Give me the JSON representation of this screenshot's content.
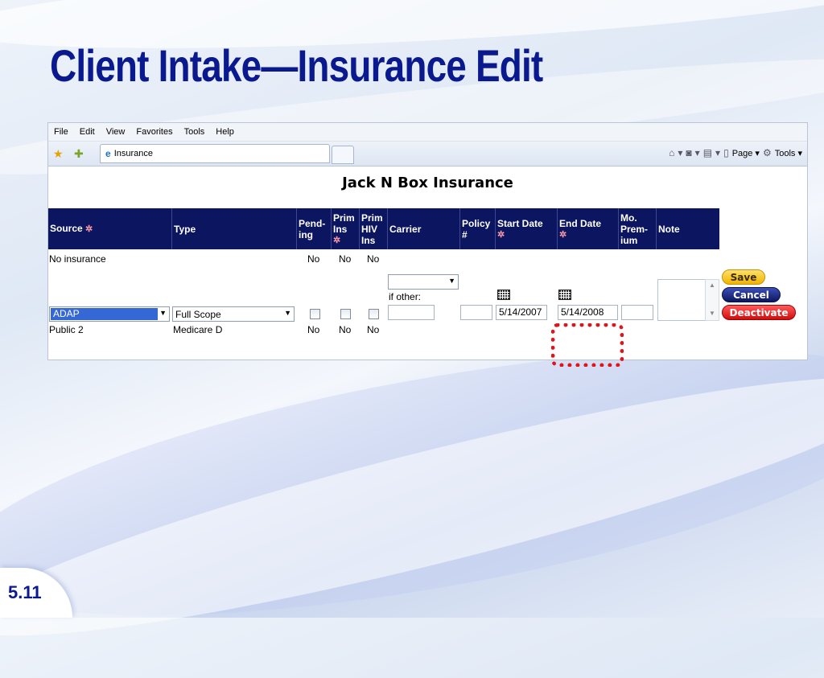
{
  "slide": {
    "title": "Client Intake—Insurance Edit",
    "number": "5.11"
  },
  "browser": {
    "menu": [
      "File",
      "Edit",
      "View",
      "Favorites",
      "Tools",
      "Help"
    ],
    "tab_title": "Insurance",
    "tools": {
      "page": "Page ▾",
      "tools": "Tools ▾"
    }
  },
  "page": {
    "heading": "Jack N Box Insurance",
    "columns": {
      "source": "Source",
      "type": "Type",
      "pending": [
        "Pend-",
        "ing"
      ],
      "prim_ins": [
        "Prim",
        "Ins"
      ],
      "prim_hiv": [
        "Prim",
        "HIV",
        "Ins"
      ],
      "carrier": "Carrier",
      "policy": [
        "Policy",
        "#"
      ],
      "start": "Start Date",
      "end": "End Date",
      "premium": [
        "Mo.",
        "Prem-",
        "ium"
      ],
      "note": "Note"
    },
    "rows": [
      {
        "source": "No insurance",
        "type": "",
        "pending": "No",
        "prim_ins": "No",
        "prim_hiv": "No"
      },
      {
        "source": "Public 2",
        "type": "Medicare D",
        "pending": "No",
        "prim_ins": "No",
        "prim_hiv": "No"
      }
    ],
    "edit_row": {
      "source_value": "ADAP",
      "type_value": "Full Scope",
      "carrier_other_label": "if other:",
      "start_date": "5/14/2007",
      "end_date": "5/14/2008"
    },
    "buttons": {
      "save": "Save",
      "cancel": "Cancel",
      "deactivate": "Deactivate"
    }
  }
}
